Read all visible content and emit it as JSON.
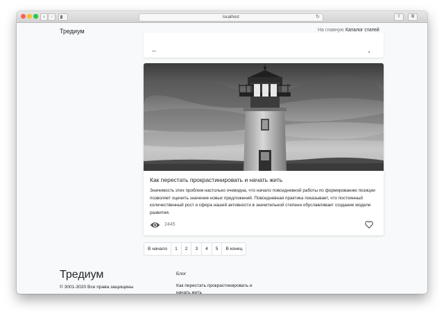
{
  "browser": {
    "url": "localhost",
    "back_glyph": "‹",
    "forward_glyph": "›",
    "reload_glyph": "↻",
    "share_glyph": "⇧",
    "tabs_glyph": "⧉"
  },
  "header": {
    "brand": "Тредиум",
    "nav": [
      {
        "label": "На главную",
        "active": false
      },
      {
        "label": "Каталог статей",
        "active": true
      }
    ],
    "accent_color": "#0d6efd"
  },
  "article": {
    "image": "lighthouse-photo",
    "title": "Как перестать прокрастинировать и начать жить",
    "excerpt": "Значимость этих проблем настолько очевидна, что начало повседневной работы по формированию позиции позволяет оценить значение новых предложений. Повседневная практика показывает, что постоянный количественный рост и сфера нашей активности в значительной степени обуславливает создание модели развития.",
    "views": "2445",
    "view_icon": "eye-icon",
    "like_icon": "heart-icon"
  },
  "pagination": {
    "first": "В начало",
    "pages": [
      "1",
      "2",
      "3",
      "4",
      "5"
    ],
    "last": "В конец"
  },
  "footer": {
    "brand": "Тредиум",
    "copyright": "© 3001-3020 Все права защищены",
    "section_title": "Блог",
    "link": "Как перестать прокрастинировать и начать жить"
  }
}
